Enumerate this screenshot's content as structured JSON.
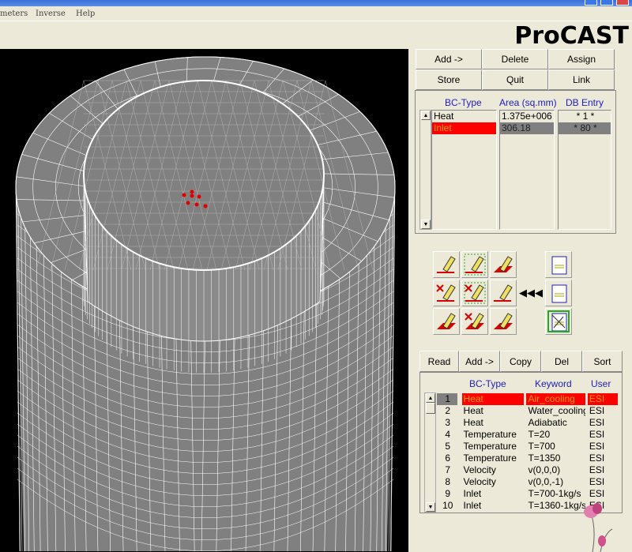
{
  "menu": [
    "meters",
    "Inverse",
    "Help"
  ],
  "logo": "ProCAST",
  "top_buttons": [
    [
      "Add ->",
      "Delete",
      "Assign"
    ],
    [
      "Store",
      "Quit",
      "Link"
    ]
  ],
  "assigned": {
    "headers": [
      "BC-Type",
      "Area (sq.mm)",
      "DB Entry"
    ],
    "rows": [
      [
        "Heat",
        "1.375e+006",
        "* 1 *"
      ],
      [
        "Inlet",
        "306.18",
        "* 80 *"
      ]
    ],
    "selected_row": 1
  },
  "tools": [
    "assign-surface-icon",
    "assign-surface-box-icon",
    "assign-surface-shaded-icon",
    "delete-surface-icon",
    "delete-surface-box-icon",
    "assign-volume-icon",
    "assign-face-icon",
    "delete-face-icon",
    "unassign-face-icon",
    "copy-documents-icon",
    "triple-left-arrow-icon",
    "paste-clipboard-icon",
    "cut-scissors-icon"
  ],
  "db_buttons": [
    "Read",
    "Add ->",
    "Copy",
    "Del",
    "Sort"
  ],
  "database": {
    "headers": [
      "BC-Type",
      "Keyword",
      "User"
    ],
    "rows": [
      [
        "1",
        "Heat",
        "Air_cooling",
        "ESI"
      ],
      [
        "2",
        "Heat",
        "Water_cooling",
        "ESI"
      ],
      [
        "3",
        "Heat",
        "Adiabatic",
        "ESI"
      ],
      [
        "4",
        "Temperature",
        "T=20",
        "ESI"
      ],
      [
        "5",
        "Temperature",
        "T=700",
        "ESI"
      ],
      [
        "6",
        "Temperature",
        "T=1350",
        "ESI"
      ],
      [
        "7",
        "Velocity",
        "v(0,0,0)",
        "ESI"
      ],
      [
        "8",
        "Velocity",
        "v(0,0,-1)",
        "ESI"
      ],
      [
        "9",
        "Inlet",
        "T=700-1kg/s",
        "ESI"
      ],
      [
        "10",
        "Inlet",
        "T=1360-1kg/s",
        "ESI"
      ]
    ],
    "selected_row": 0
  },
  "colors": {
    "selected": "#ff0000",
    "header": "#2020c0",
    "mesh": "#808080"
  }
}
